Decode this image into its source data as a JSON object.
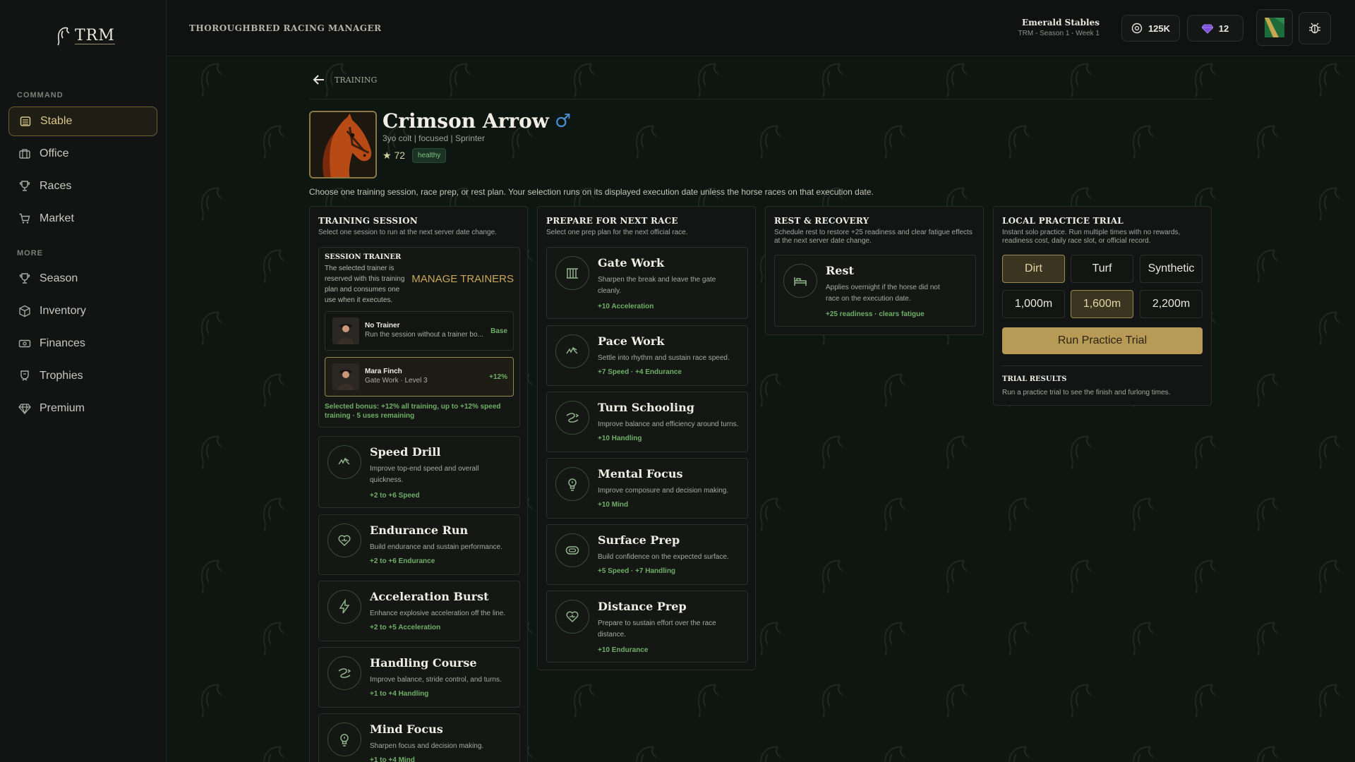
{
  "sidebar": {
    "logo": "TRM",
    "sections": [
      {
        "heading": "COMMAND",
        "items": [
          {
            "label": "Stable",
            "icon": "stable-icon",
            "active": true
          },
          {
            "label": "Office",
            "icon": "office-icon"
          },
          {
            "label": "Races",
            "icon": "trophy-icon"
          },
          {
            "label": "Market",
            "icon": "cart-icon"
          }
        ]
      },
      {
        "heading": "MORE",
        "items": [
          {
            "label": "Season",
            "icon": "trophy-icon"
          },
          {
            "label": "Inventory",
            "icon": "box-icon"
          },
          {
            "label": "Finances",
            "icon": "money-icon"
          },
          {
            "label": "Trophies",
            "icon": "award-icon"
          },
          {
            "label": "Premium",
            "icon": "gem-icon"
          }
        ]
      }
    ]
  },
  "topbar": {
    "title": "THOROUGHBRED RACING MANAGER",
    "stable_name": "Emerald Stables",
    "stable_sub": "TRM - Season 1 - Week 1",
    "coins": "125K",
    "gems": "12"
  },
  "main": {
    "back_label": "TRAINING",
    "horse": {
      "name": "Crimson Arrow",
      "sex_symbol": "♂",
      "sub": "3yo colt | focused | Sprinter",
      "rating": "★ 72",
      "status": "healthy"
    },
    "intro": "Choose one training session, race prep, or rest plan. Your selection runs on its displayed execution date unless the horse races on that execution date.",
    "training": {
      "title": "TRAINING SESSION",
      "sub": "Select one session to run at the next server date change.",
      "trainer": {
        "heading": "SESSION TRAINER",
        "desc": "The selected trainer is reserved with this training plan and consumes one use when it executes.",
        "manage": "MANAGE TRAINERS",
        "options": [
          {
            "name": "No Trainer",
            "sub": "Run the session without a trainer bo...",
            "bonus": "Base",
            "selected": false
          },
          {
            "name": "Mara Finch",
            "sub": "Gate Work · Level 3",
            "bonus": "+12%",
            "selected": true
          }
        ],
        "selected_bonus": "Selected bonus: +12% all training, up to +12% speed training · 5 uses remaining"
      },
      "sessions": [
        {
          "title": "Speed Drill",
          "desc": "Improve top-end speed and overall quickness.",
          "bonus": "+2 to +6 Speed",
          "icon": "gallop-icon"
        },
        {
          "title": "Endurance Run",
          "desc": "Build endurance and sustain performance.",
          "bonus": "+2 to +6 Endurance",
          "icon": "heart-icon"
        },
        {
          "title": "Acceleration Burst",
          "desc": "Enhance explosive acceleration off the line.",
          "bonus": "+2 to +5 Acceleration",
          "icon": "bolt-icon"
        },
        {
          "title": "Handling Course",
          "desc": "Improve balance, stride control, and turns.",
          "bonus": "+1 to +4 Handling",
          "icon": "curve-icon"
        },
        {
          "title": "Mind Focus",
          "desc": "Sharpen focus and decision making.",
          "bonus": "+1 to +4 Mind",
          "icon": "bulb-icon"
        }
      ]
    },
    "prep": {
      "title": "PREPARE FOR NEXT RACE",
      "sub": "Select one prep plan for the next official race.",
      "items": [
        {
          "title": "Gate Work",
          "desc": "Sharpen the break and leave the gate cleanly.",
          "bonus": "+10 Acceleration",
          "icon": "gate-icon"
        },
        {
          "title": "Pace Work",
          "desc": "Settle into rhythm and sustain race speed.",
          "bonus": "+7 Speed · +4 Endurance",
          "icon": "gallop-icon"
        },
        {
          "title": "Turn Schooling",
          "desc": "Improve balance and efficiency around turns.",
          "bonus": "+10 Handling",
          "icon": "curve-icon"
        },
        {
          "title": "Mental Focus",
          "desc": "Improve composure and decision making.",
          "bonus": "+10 Mind",
          "icon": "bulb-icon"
        },
        {
          "title": "Surface Prep",
          "desc": "Build confidence on the expected surface.",
          "bonus": "+5 Speed · +7 Handling",
          "icon": "track-icon"
        },
        {
          "title": "Distance Prep",
          "desc": "Prepare to sustain effort over the race distance.",
          "bonus": "+10 Endurance",
          "icon": "heart-icon"
        }
      ]
    },
    "rest": {
      "title": "REST & RECOVERY",
      "sub": "Schedule rest to restore +25 readiness and clear fatigue effects at the next server date change.",
      "item": {
        "title": "Rest",
        "desc": "Applies overnight if the horse did not race on the execution date.",
        "bonus": "+25 readiness · clears fatigue",
        "icon": "bed-icon"
      }
    },
    "practice": {
      "title": "LOCAL PRACTICE TRIAL",
      "sub": "Instant solo practice. Run multiple times with no rewards, readiness cost, daily race slot, or official record.",
      "surfaces": [
        "Dirt",
        "Turf",
        "Synthetic"
      ],
      "selected_surface": "Dirt",
      "distances": [
        "1,000m",
        "1,600m",
        "2,200m"
      ],
      "selected_distance": "1,600m",
      "run_label": "Run Practice Trial",
      "results_title": "TRIAL RESULTS",
      "results_text": "Run a practice trial to see the finish and furlong times."
    }
  },
  "colors": {
    "accent": "#b79a55",
    "bonus_green": "#6fae66",
    "background": "#0d1611"
  }
}
